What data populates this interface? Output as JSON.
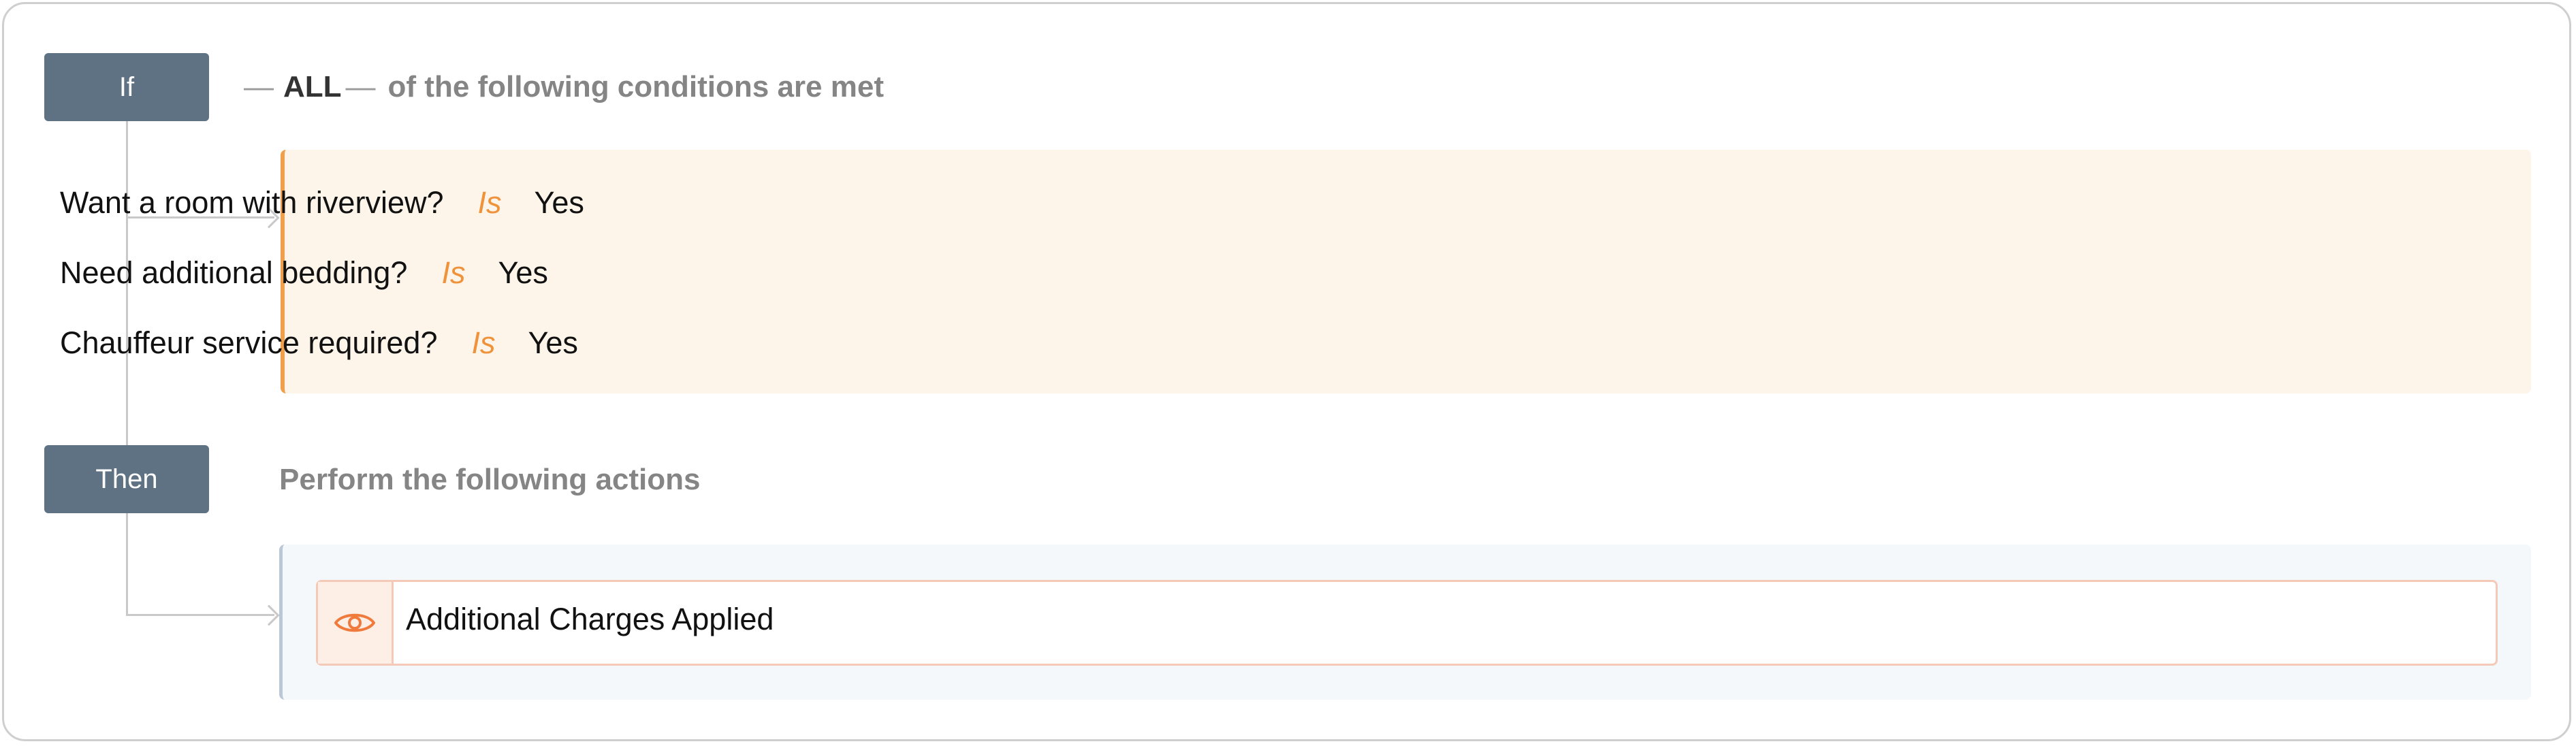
{
  "rule": {
    "if_label": "If",
    "then_label": "Then",
    "match_operator": "ALL",
    "if_caption": "of the following conditions are met",
    "then_caption": "Perform the following actions",
    "conditions": [
      {
        "field": "Want a room with riverview?",
        "operator": "Is",
        "value": "Yes"
      },
      {
        "field": "Need additional bedding?",
        "operator": "Is",
        "value": "Yes"
      },
      {
        "field": "Chauffeur service required?",
        "operator": "Is",
        "value": "Yes"
      }
    ],
    "actions": [
      {
        "icon": "eye-icon",
        "label": "Additional Charges Applied"
      }
    ]
  },
  "colors": {
    "tag_background": "#5f7283",
    "condition_accent": "#f0a04b",
    "condition_background": "#fdf4ea",
    "operator_text": "#f0923a",
    "action_border": "#f5c9b8",
    "action_icon": "#f07a3c"
  }
}
